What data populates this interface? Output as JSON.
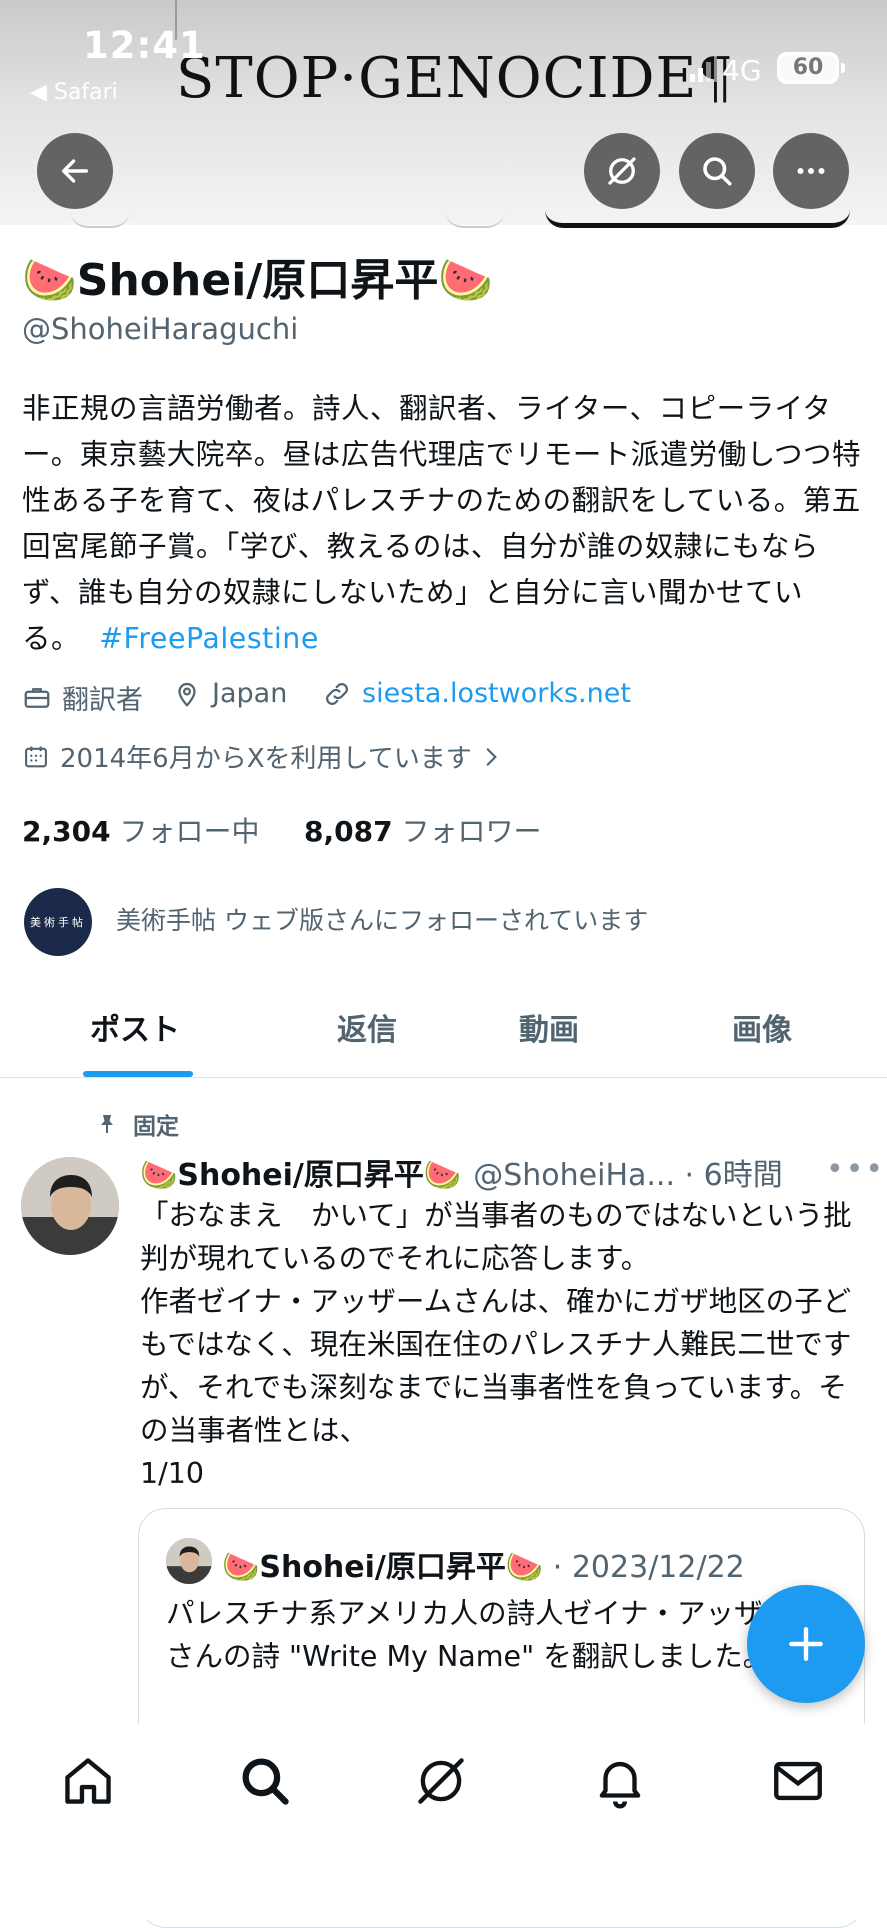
{
  "status_bar": {
    "time": "12:41",
    "back_app": "◀ Safari",
    "network": "4G",
    "battery": "60"
  },
  "banner": {
    "text": "STOP·GENOCIDE¶"
  },
  "profile": {
    "display_name": "🍉Shohei/原口昇平🍉",
    "handle": "@ShoheiHaraguchi",
    "bio": "非正規の言語労働者。詩人、翻訳者、ライター、コピーライター。東京藝大院卒。昼は広告代理店でリモート派遣労働しつつ特性ある子を育て、夜はパレスチナのための翻訳をしている。第五回宮尾節子賞。「学び、教えるのは、自分が誰の奴隷にもならず、誰も自分の奴隷にしないため」と自分に言い聞かせている。",
    "bio_hashtag": "#FreePalestine",
    "job": "翻訳者",
    "location": "Japan",
    "website": "siesta.lostworks.net",
    "joined": "2014年6月からXを利用しています",
    "following_count": "2,304",
    "following_label": "フォロー中",
    "followers_count": "8,087",
    "followers_label": "フォロワー",
    "followed_by_avatar_text": "美術手帖",
    "followed_by": "美術手帖 ウェブ版さんにフォローされています"
  },
  "tabs": [
    {
      "label": "ポスト",
      "active": true
    },
    {
      "label": "返信",
      "active": false
    },
    {
      "label": "動画",
      "active": false
    },
    {
      "label": "画像",
      "active": false
    }
  ],
  "pinned_post": {
    "pin_label": "固定",
    "name": "🍉Shohei/原口昇平🍉",
    "handle_time": "@ShoheiHa... · 6時間",
    "text": "「おなまえ　かいて」が当事者のものではないという批判が現れているのでそれに応答します。\n作者ゼイナ・アッザームさんは、確かにガザ地区の子どもではなく、現在米国在住のパレスチナ人難民二世ですが、それでも深刻なまでに当事者性を負っています。その当事者性とは、\n1/10",
    "quote": {
      "name": "🍉Shohei/原口昇平🍉",
      "date": " · 2023/12/22",
      "text": "パレスチナ系アメリカ人の詩人ゼイナ・アッザームさんの詩 \"Write My Name\" を翻訳しました。"
    }
  },
  "colors": {
    "accent": "#1d9bf0",
    "text_primary": "#0f1419",
    "text_secondary": "#536471"
  },
  "icons": {
    "back": "arrow-left-icon",
    "grok": "grok-icon",
    "search": "search-icon",
    "more": "more-icon",
    "compose": "plus-icon",
    "nav": [
      "home-icon",
      "search-icon",
      "grok-icon",
      "bell-icon",
      "mail-icon"
    ]
  }
}
